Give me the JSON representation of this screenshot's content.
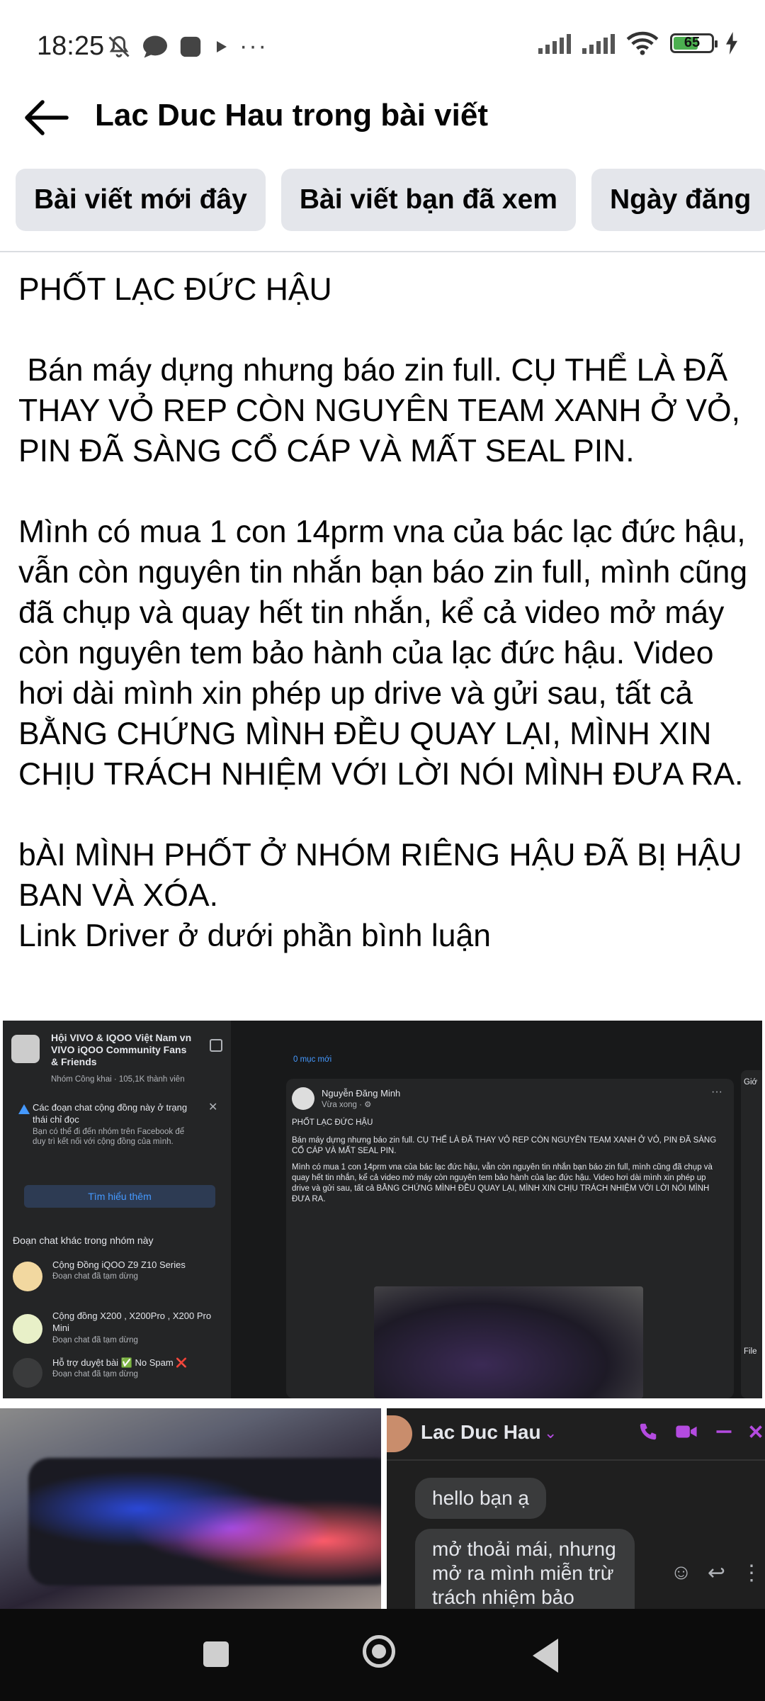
{
  "status_bar": {
    "time": "18:25",
    "battery": "65",
    "left_icons": [
      "mute-icon",
      "chat-bubble-icon",
      "app-icon",
      "play-icon",
      "more-dots-icon"
    ],
    "right_icons": [
      "signal-icon",
      "signal-icon",
      "wifi-icon",
      "battery-icon",
      "charging-icon"
    ],
    "more_dots": "···"
  },
  "header": {
    "title": "Lac Duc Hau trong bài viết",
    "back_icon": "back-arrow-icon"
  },
  "filter_chips": [
    {
      "label": "Bài viết mới đây"
    },
    {
      "label": "Bài viết bạn đã xem"
    },
    {
      "label": "Ngày đăng"
    }
  ],
  "post": {
    "text": "PHỐT LẠC ĐỨC HẬU\n\n Bán máy dựng nhưng báo zin full. CỤ THỂ LÀ ĐÃ THAY VỎ REP CÒN NGUYÊN TEAM XANH Ở VỎ, PIN ĐÃ SÀNG CỔ CÁP VÀ MẤT SEAL PIN.\n\nMình có mua 1 con 14prm vna của bác lạc đức hậu, vẫn còn nguyên tin nhắn bạn báo zin full, mình cũng đã chụp và quay hết tin nhắn, kể cả video mở máy còn nguyên tem bảo hành của lạc đức hậu. Video hơi dài mình xin phép up drive và gửi sau, tất cả BẰNG CHỨNG MÌNH ĐỀU QUAY LẠI, MÌNH XIN CHỊU TRÁCH NHIỆM VỚI LỜI NÓI MÌNH ĐƯA RA.\n\nbÀI MÌNH PHỐT Ở NHÓM RIÊNG HẬU ĐÃ BỊ HẬU BAN VÀ XÓA.\nLink Driver ở dưới phần bình luận"
  },
  "screenshot1": {
    "group_name": "Hội VIVO & IQOO Việt Nam vn VIVO iQOO Community Fans & Friends",
    "group_meta": "Nhóm Công khai · 105,1K thành viên",
    "warning_title": "Các đoạn chat cộng đồng này ở trạng thái chỉ đọc",
    "warning_body": "Bạn có thể đi đến nhóm trên Facebook để duy trì kết nối với cộng đồng của mình.",
    "learn_more": "Tìm hiểu thêm",
    "other_chats_title": "Đoạn chat khác trong nhóm này",
    "chats": [
      {
        "name": "Cộng Đồng iQOO Z9 Z10 Series",
        "status": "Đoạn chat đã tạm dừng"
      },
      {
        "name": "Cộng đồng X200 , X200Pro , X200 Pro Mini",
        "status": "Đoạn chat đã tạm dừng"
      },
      {
        "name": "Hỗ trợ duyệt bài ✅ No Spam ❌",
        "status": "Đoạn chat đã tạm dừng"
      }
    ],
    "author": "Nguyễn Đăng Minh",
    "author_meta": "Vừa xong · ⚙",
    "card_text_1": "PHỐT LẠC ĐỨC HẬU",
    "card_text_2": "Bán máy dựng nhưng báo zin full. CỤ THỂ LÀ ĐÃ THAY VỎ REP CÒN NGUYÊN TEAM XANH Ở VỎ, PIN ĐÃ SÀNG CỔ CÁP VÀ MẤT SEAL PIN.",
    "card_text_3": "Mình có mua 1 con 14prm vna của bác lạc đức hậu, vẫn còn nguyên tin nhắn bạn báo zin full, mình cũng đã chụp và quay hết tin nhắn, kể cả video mở máy còn nguyên tem bảo hành của lạc đức hậu. Video hơi dài mình xin phép up drive và gửi sau, tất cả BẰNG CHỨNG MÌNH ĐỀU QUAY LẠI, MÌNH XIN CHỊU TRÁCH NHIỆM VỚI LỜI NÓI MÌNH ĐƯA RA.",
    "card_top": "0 mục mới",
    "right_panel_1": "Giớ",
    "right_panel_2": "File"
  },
  "screenshot3": {
    "contact_name": "Lac Duc Hau",
    "bubble_1": "hello bạn ạ",
    "bubble_2": "mở thoải mái, nhưng mở ra mình miễn trừ trách nhiệm bảo hành"
  },
  "nav": {
    "icons": [
      "recent-apps-icon",
      "home-icon",
      "back-icon"
    ]
  }
}
